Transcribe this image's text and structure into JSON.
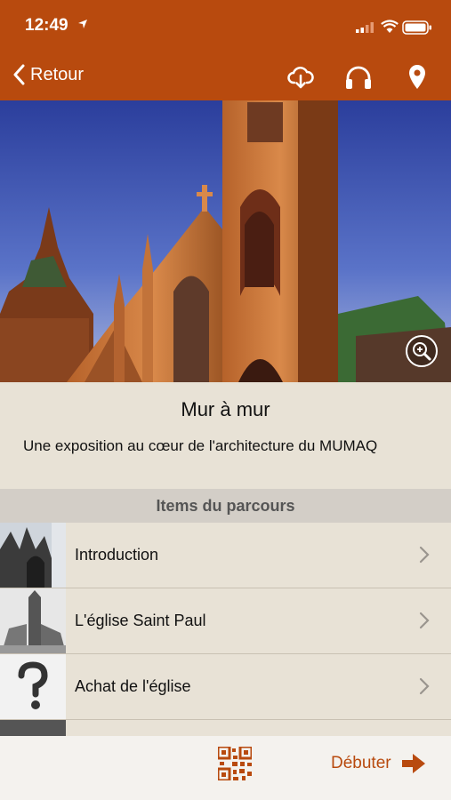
{
  "status_bar": {
    "time": "12:49"
  },
  "nav": {
    "back_label": "Retour"
  },
  "exhibit": {
    "title": "Mur à mur",
    "description": "Une exposition au cœur de l'architecture du MUMAQ"
  },
  "section": {
    "title": "Items du parcours"
  },
  "items": [
    {
      "label": "Introduction"
    },
    {
      "label": "L'église Saint Paul"
    },
    {
      "label": "Achat de l'église"
    }
  ],
  "footer": {
    "start_label": "Débuter"
  },
  "colors": {
    "accent": "#b84a0e",
    "background": "#e8e2d6",
    "section": "#d3cec7"
  },
  "icons": [
    "back-chevron-icon",
    "cloud-download-icon",
    "headphones-icon",
    "map-pin-icon",
    "zoom-in-icon",
    "qr-code-icon",
    "play-arrow-icon"
  ]
}
